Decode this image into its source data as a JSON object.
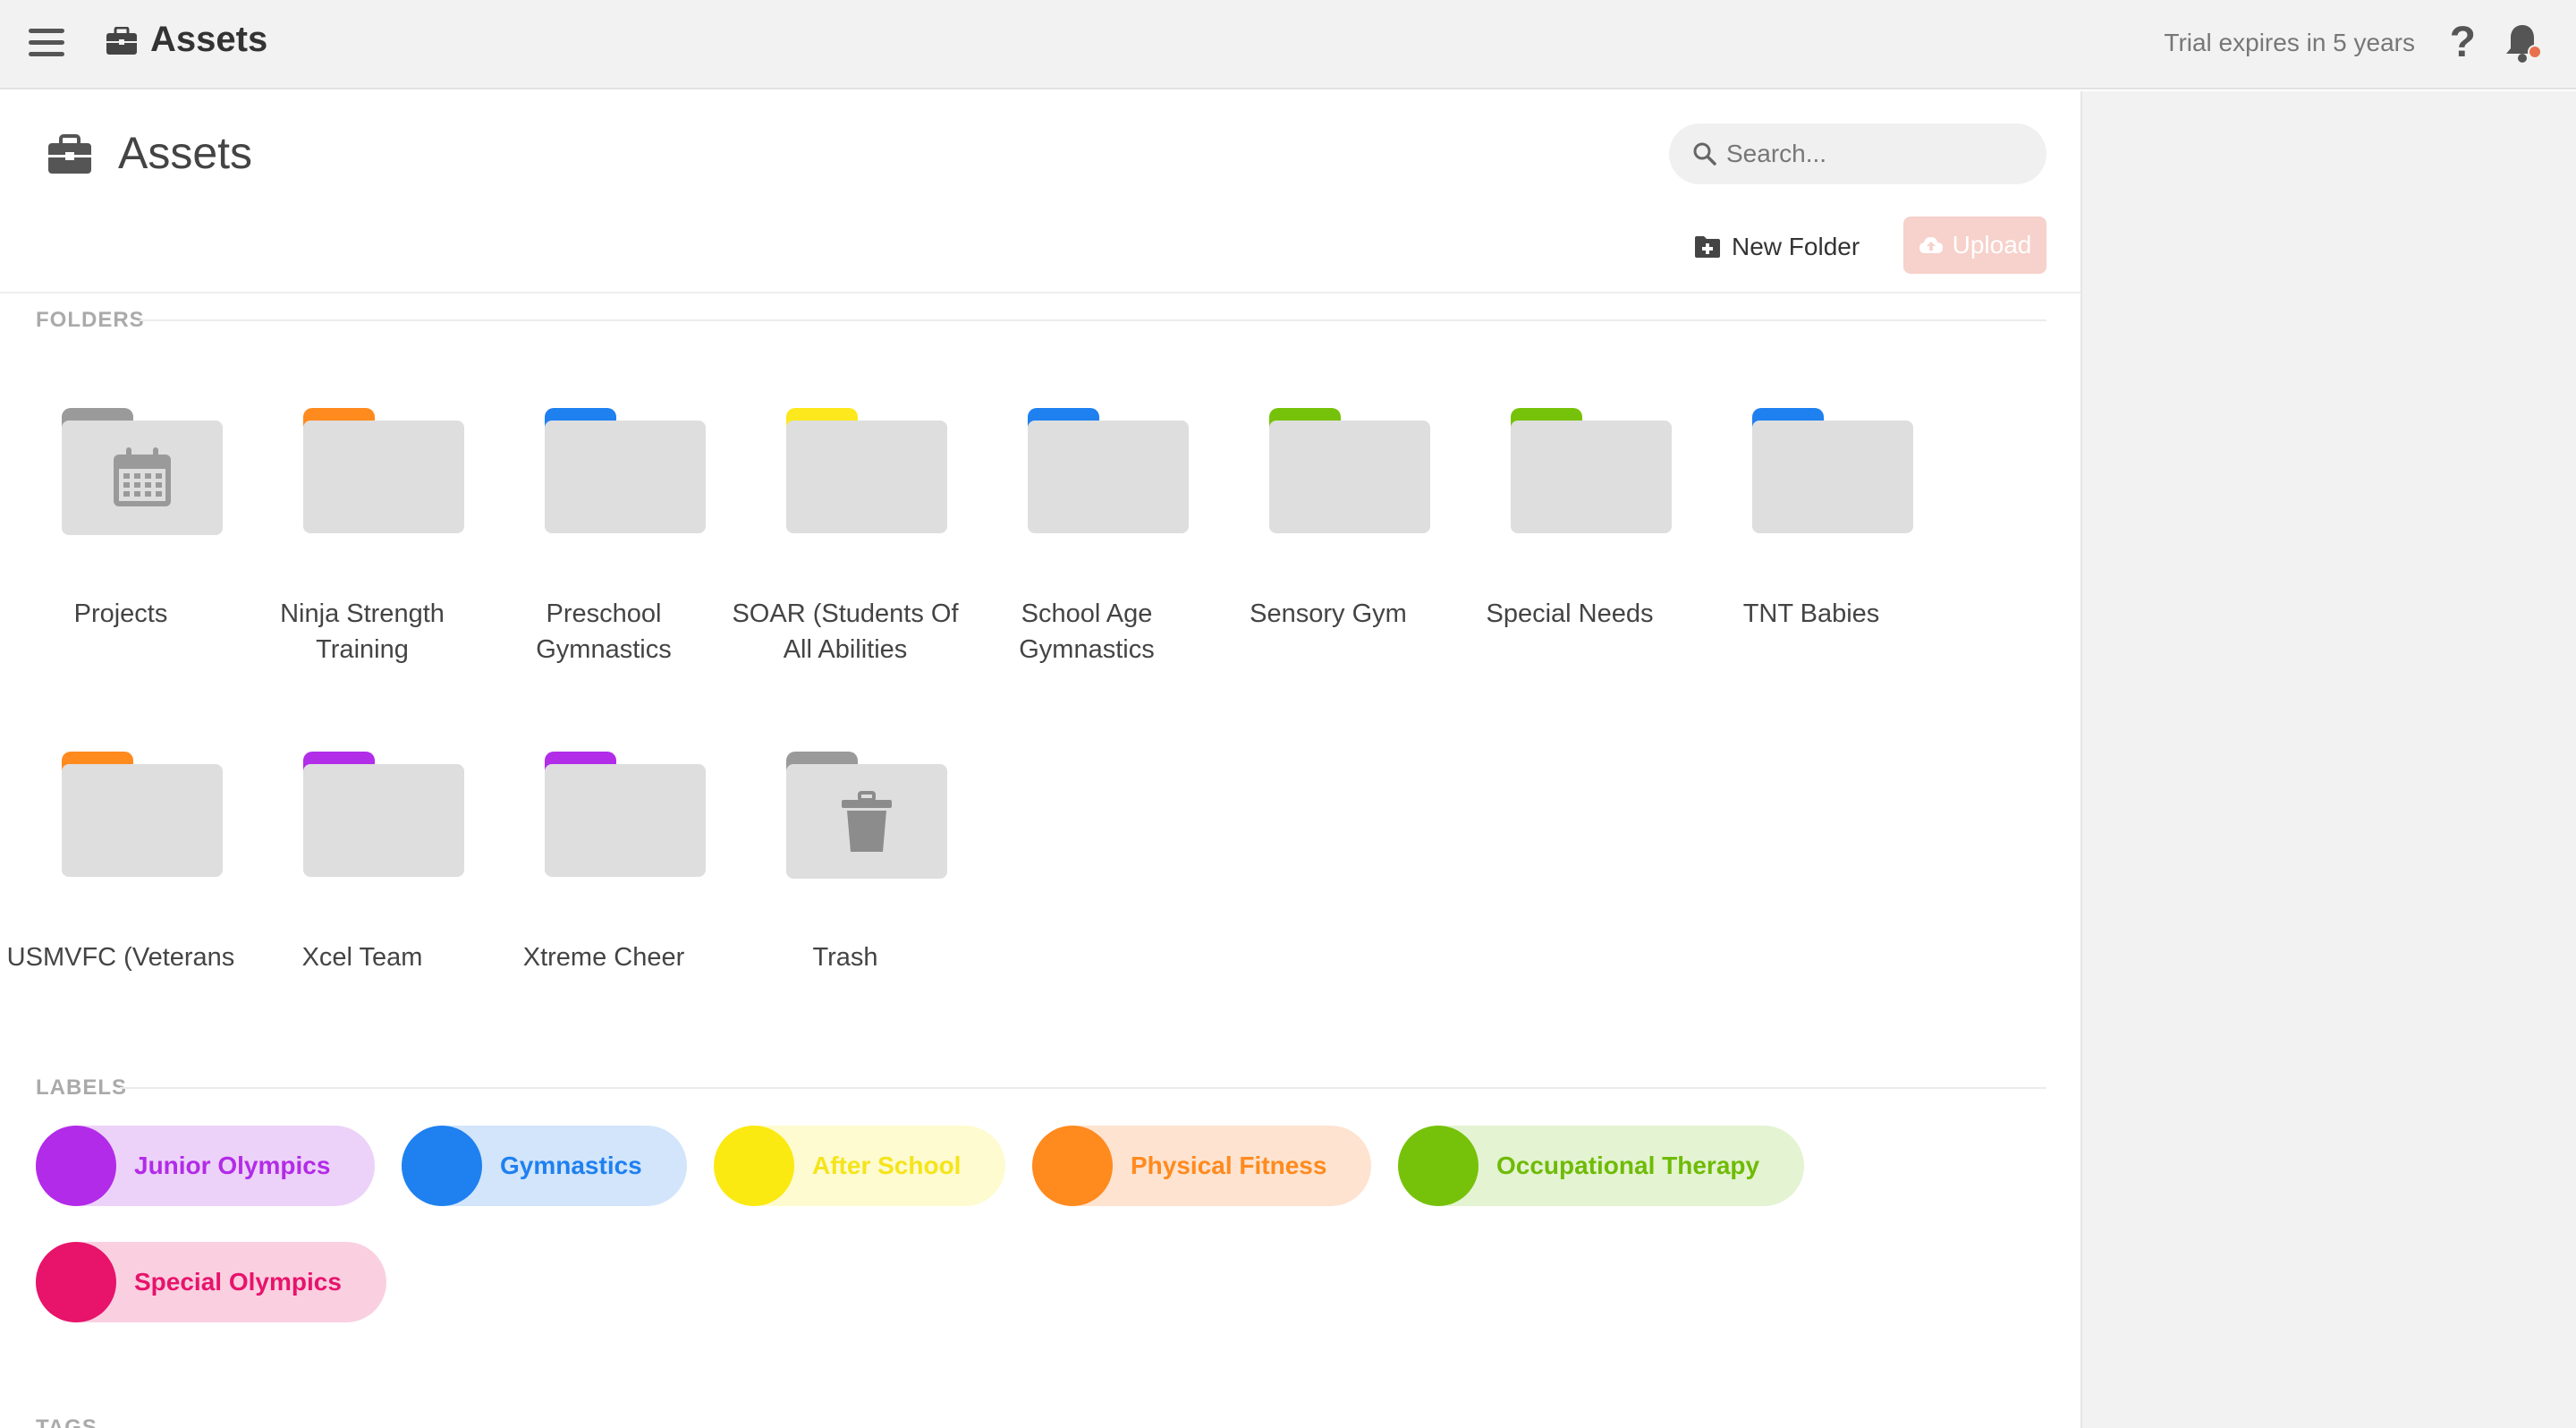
{
  "topbar": {
    "app_title": "Assets",
    "trial_text": "Trial expires in 5 years",
    "help_label": "?"
  },
  "page": {
    "title": "Assets",
    "search_placeholder": "Search...",
    "new_folder_label": "New Folder",
    "upload_label": "Upload"
  },
  "sections": {
    "folders": "FOLDERS",
    "labels": "LABELS",
    "tags": "TAGS"
  },
  "folders": [
    {
      "name": "Projects",
      "tab_color": "#9a9a9a",
      "emblem": "calendar-icon"
    },
    {
      "name": "Ninja Strength Training",
      "tab_color": "#ff8a1e"
    },
    {
      "name": "Preschool Gymnastics",
      "tab_color": "#1f80f0"
    },
    {
      "name": "SOAR (Students Of All Abilities",
      "tab_color": "#fce81c"
    },
    {
      "name": "School Age Gymnastics",
      "tab_color": "#1f80f0"
    },
    {
      "name": "Sensory Gym",
      "tab_color": "#76c20a"
    },
    {
      "name": "Special Needs",
      "tab_color": "#76c20a"
    },
    {
      "name": "TNT Babies",
      "tab_color": "#1f80f0"
    },
    {
      "name": "USMVFC (Veterans",
      "tab_color": "#ff8a1e"
    },
    {
      "name": "Xcel Team",
      "tab_color": "#b12de8"
    },
    {
      "name": "Xtreme Cheer",
      "tab_color": "#b12de8"
    },
    {
      "name": "Trash",
      "tab_color": "#9a9a9a",
      "emblem": "trash-icon"
    }
  ],
  "labels": [
    {
      "name": "Junior Olympics",
      "color": "#b22be8",
      "bg": "#ecd2f8",
      "text_color": "#b22be8"
    },
    {
      "name": "Gymnastics",
      "color": "#1f80f0",
      "bg": "#d2e5fb",
      "text_color": "#1f80f0"
    },
    {
      "name": "After School",
      "color": "#fbe912",
      "bg": "#fefbd0",
      "text_color": "#f5e41a"
    },
    {
      "name": "Physical Fitness",
      "color": "#ff8a1e",
      "bg": "#fee3d0",
      "text_color": "#ff8a1e"
    },
    {
      "name": "Occupational Therapy",
      "color": "#76c20a",
      "bg": "#e4f3d2",
      "text_color": "#6fbb06"
    },
    {
      "name": "Special Olympics",
      "color": "#e8136b",
      "bg": "#fad0e1",
      "text_color": "#e8136b"
    }
  ],
  "colors": {
    "topbar_bg": "#f2f2f2",
    "upload_bg": "#f7d1cb",
    "notification_dot": "#e8704f"
  }
}
